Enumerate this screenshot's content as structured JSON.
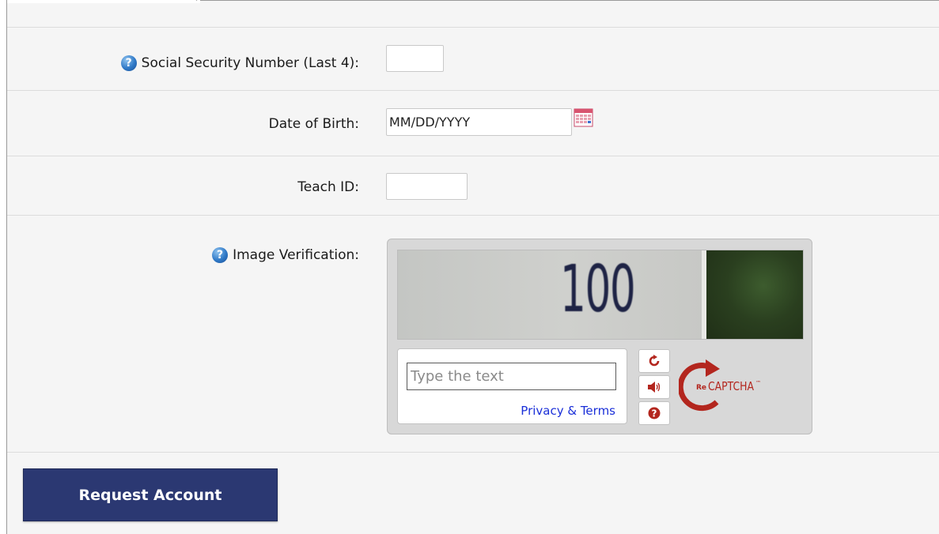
{
  "form": {
    "ssn": {
      "label": "Social Security Number (Last 4):",
      "help_icon": "question-circle-icon",
      "value": ""
    },
    "dob": {
      "label": "Date of Birth:",
      "value": "MM/DD/YYYY",
      "calendar_icon": "calendar-icon"
    },
    "teach_id": {
      "label": "Teach ID:",
      "value": ""
    },
    "image_verification": {
      "label": "Image Verification:",
      "help_icon": "question-circle-icon"
    }
  },
  "captcha": {
    "challenge_text": "100",
    "input_placeholder": "Type the text",
    "privacy_link": "Privacy & Terms",
    "refresh_icon": "refresh-icon",
    "audio_icon": "audio-icon",
    "help_icon": "help-icon",
    "logo_prefix": "Re",
    "logo_text": "CAPTCHA",
    "logo_tm": "™"
  },
  "actions": {
    "submit_label": "Request Account"
  },
  "colors": {
    "button_bg": "#2b3872",
    "link": "#1a2fd8",
    "recaptcha_red": "#b3261e"
  }
}
